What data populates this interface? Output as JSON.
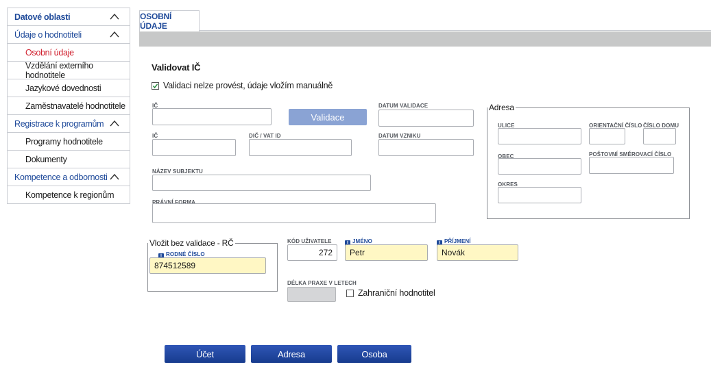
{
  "sidebar": {
    "datove_oblasti": "Datové oblasti",
    "udaje_o_hodnotiteli": "Údaje o hodnotiteli",
    "osobni_udaje": "Osobní údaje",
    "vzdelani": "Vzdělání externího hodnotitele",
    "jazykove": "Jazykové dovednosti",
    "zamestnavatele": "Zaměstnavatelé hodnotitele",
    "registrace": "Registrace k programům",
    "programy": "Programy hodnotitele",
    "dokumenty": "Dokumenty",
    "kompetence": "Kompetence a odbornosti",
    "kompetence_regiony": "Kompetence k regionům"
  },
  "tab": {
    "label": "OSOBNÍ ÚDAJE"
  },
  "form": {
    "title": "Validovat IČ",
    "manual_checkbox_label": "Validaci nelze provést, údaje vložím manuálně",
    "manual_checked": true,
    "ic_label_1": "IČ",
    "validate_button": "Validace",
    "datum_validace_label": "DATUM VALIDACE",
    "ic_label_2": "IČ",
    "dic_label": "DIČ / VAT ID",
    "datum_vzniku_label": "DATUM VZNIKU",
    "nazev_label": "NÁZEV SUBJEKTU",
    "pravni_forma_label": "PRÁVNÍ FORMA"
  },
  "adresa": {
    "legend": "Adresa",
    "ulice": "ULICE",
    "orientacni": "ORIENTAČNÍ ČÍSLO",
    "cislo_domu": "ČÍSLO DOMU",
    "obec": "OBEC",
    "psc": "POŠTOVNÍ SMĚROVACÍ ČÍSLO",
    "okres": "OKRES"
  },
  "rc": {
    "legend": "Vložit bez validace - RČ",
    "label": "RODNÉ ČÍSLO",
    "value": "874512589"
  },
  "person": {
    "kod_label": "KÓD UŽIVATELE",
    "kod_value": "272",
    "jmeno_label": "JMÉNO",
    "jmeno_value": "Petr",
    "prijmeni_label": "PŘÍJMENÍ",
    "prijmeni_value": "Novák",
    "praxe_label": "DÉLKA PRAXE V LETECH",
    "zahranicni_label": "Zahraniční hodnotitel",
    "info_icon_glyph": "i"
  },
  "buttons": {
    "ucet": "Účet",
    "adresa": "Adresa",
    "osoba": "Osoba"
  },
  "colors": {
    "accent": "#1f4a9a",
    "active": "#d0202e",
    "required_fill": "#fff7c4",
    "button": "#1f4399"
  }
}
